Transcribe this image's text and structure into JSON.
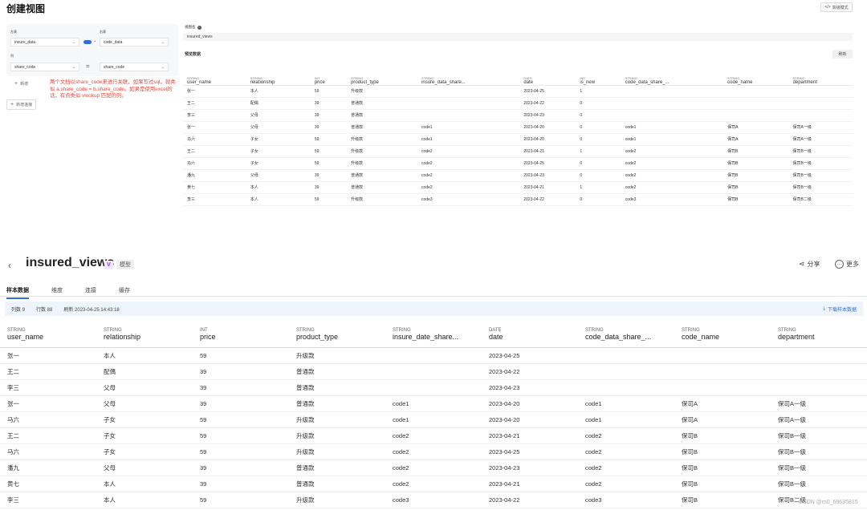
{
  "top": {
    "title": "创建视图",
    "advanced_label": "高级模式",
    "left_table_label": "左表",
    "right_table_label": "右表",
    "left_table_value": "insure_data",
    "right_table_value": "code_data",
    "column_label": "列",
    "left_column_value": "share_code",
    "right_column_value": "share_code",
    "equals": "=",
    "add_label": "新增",
    "add_join_label": "新增连接",
    "annotation": "两个文档以share_code来进行关联，如果写过sql，就类似 a.share_code = b.share_code。如果是使用excel的话，有点类似 vlookup 匹配的列。",
    "view_name_label": "视图名",
    "view_name_value": "insured_views",
    "preview_label": "预览数据",
    "refresh_label": "刷新",
    "columns": [
      {
        "type": "STRING",
        "name": "user_name"
      },
      {
        "type": "STRING",
        "name": "relationship"
      },
      {
        "type": "INT",
        "name": "price"
      },
      {
        "type": "STRING",
        "name": "product_type"
      },
      {
        "type": "STRING",
        "name": "insure_data_share..."
      },
      {
        "type": "DATE",
        "name": "date"
      },
      {
        "type": "INT",
        "name": "is_new"
      },
      {
        "type": "STRING",
        "name": "code_data_share_..."
      },
      {
        "type": "STRING",
        "name": "code_name"
      },
      {
        "type": "STRING",
        "name": "department"
      }
    ],
    "rows": [
      [
        "张一",
        "本人",
        "59",
        "升级款",
        "",
        "2023-04-25",
        "1",
        "",
        "",
        ""
      ],
      [
        "王二",
        "配偶",
        "39",
        "普通款",
        "",
        "2023-04-22",
        "0",
        "",
        "",
        ""
      ],
      [
        "李三",
        "父母",
        "39",
        "普通款",
        "",
        "2023-04-23",
        "0",
        "",
        "",
        ""
      ],
      [
        "张一",
        "父母",
        "39",
        "普通款",
        "code1",
        "2023-04-20",
        "0",
        "code1",
        "保司A",
        "保司A一级"
      ],
      [
        "马六",
        "子女",
        "59",
        "升级款",
        "code1",
        "2023-04-20",
        "0",
        "code1",
        "保司A",
        "保司A一级"
      ],
      [
        "王二",
        "子女",
        "59",
        "升级款",
        "code2",
        "2023-04-21",
        "1",
        "code2",
        "保司B",
        "保司B一级"
      ],
      [
        "马六",
        "子女",
        "59",
        "升级款",
        "code2",
        "2023-04-25",
        "0",
        "code2",
        "保司B",
        "保司B一级"
      ],
      [
        "潘九",
        "父母",
        "39",
        "普通款",
        "code2",
        "2023-04-23",
        "0",
        "code2",
        "保司B",
        "保司B一级"
      ],
      [
        "黄七",
        "本人",
        "39",
        "普通款",
        "code2",
        "2023-04-21",
        "1",
        "code2",
        "保司B",
        "保司B一级"
      ],
      [
        "李三",
        "本人",
        "59",
        "升级款",
        "code3",
        "2023-04-22",
        "0",
        "code3",
        "保司B",
        "保司B二级"
      ]
    ]
  },
  "bottom": {
    "title": "insured_views",
    "badge": "V",
    "type_tag": "模型",
    "share_label": "分享",
    "more_label": "更多",
    "tabs": [
      "样本数据",
      "维度",
      "连接",
      "缓存"
    ],
    "stats": {
      "cols": "列数 9",
      "rows": "行数 88",
      "refreshed": "刷新 2023-04-25 14:43:18"
    },
    "download_label": "下载样本数据",
    "columns": [
      {
        "type": "STRING",
        "name": "user_name"
      },
      {
        "type": "STRING",
        "name": "relationship"
      },
      {
        "type": "INT",
        "name": "price"
      },
      {
        "type": "STRING",
        "name": "product_type"
      },
      {
        "type": "STRING",
        "name": "insure_date_share..."
      },
      {
        "type": "DATE",
        "name": "date"
      },
      {
        "type": "STRING",
        "name": "code_data_share_..."
      },
      {
        "type": "STRING",
        "name": "code_name"
      },
      {
        "type": "STRING",
        "name": "department"
      }
    ],
    "rows": [
      [
        "张一",
        "本人",
        "59",
        "升级款",
        "",
        "2023-04-25",
        "",
        "",
        ""
      ],
      [
        "王二",
        "配偶",
        "39",
        "普通款",
        "",
        "2023-04-22",
        "",
        "",
        ""
      ],
      [
        "李三",
        "父母",
        "39",
        "普通款",
        "",
        "2023-04-23",
        "",
        "",
        ""
      ],
      [
        "张一",
        "父母",
        "39",
        "普通款",
        "code1",
        "2023-04-20",
        "code1",
        "保司A",
        "保司A一级"
      ],
      [
        "马六",
        "子女",
        "59",
        "升级款",
        "code1",
        "2023-04-20",
        "code1",
        "保司A",
        "保司A一级"
      ],
      [
        "王二",
        "子女",
        "59",
        "升级款",
        "code2",
        "2023-04-21",
        "code2",
        "保司B",
        "保司B一级"
      ],
      [
        "马六",
        "子女",
        "59",
        "升级款",
        "code2",
        "2023-04-25",
        "code2",
        "保司B",
        "保司B一级"
      ],
      [
        "潘九",
        "父母",
        "39",
        "普通款",
        "code2",
        "2023-04-23",
        "code2",
        "保司B",
        "保司B一级"
      ],
      [
        "黄七",
        "本人",
        "39",
        "普通款",
        "code2",
        "2023-04-21",
        "code2",
        "保司B",
        "保司B一级"
      ],
      [
        "李三",
        "本人",
        "59",
        "升级款",
        "code3",
        "2023-04-22",
        "code3",
        "保司B",
        "保司B二级"
      ]
    ]
  },
  "watermark": "CSDN @m0_68635815",
  "colors": {
    "accent": "#2f6fd6",
    "annotation": "#e5483b",
    "badge": "#7b3fe4"
  }
}
